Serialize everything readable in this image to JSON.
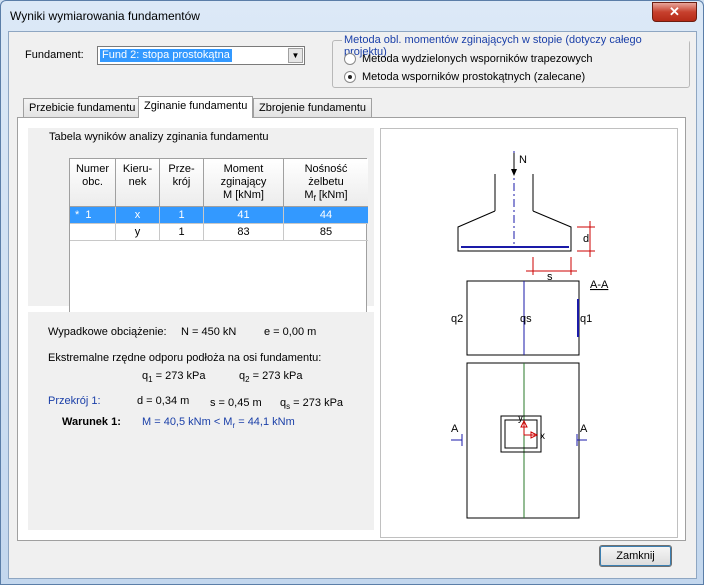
{
  "window": {
    "title": "Wyniki wymiarowania fundamentów",
    "close_glyph": "✕"
  },
  "fundament": {
    "label": "Fundament:",
    "selected": "Fund 2: stopa prostokątna"
  },
  "method": {
    "group_title": "Metoda obl. momentów zginających w stopie (dotyczy całego projektu)",
    "option1": "Metoda wydzielonych wsporników trapezowych",
    "option2": "Metoda wsporników prostokątnych (zalecane)",
    "selected": 2
  },
  "tabs": [
    {
      "label": "Przebicie fundamentu"
    },
    {
      "label": "Zginanie fundamentu"
    },
    {
      "label": "Zbrojenie fundamentu"
    }
  ],
  "table": {
    "caption": "Tabela wyników analizy zginania fundamentu",
    "headers": {
      "num": [
        "Numer",
        "obc."
      ],
      "dir": [
        "Kieru-",
        "nek"
      ],
      "sec": [
        "Prze-",
        "krój"
      ],
      "moment": [
        "Moment",
        "zginający",
        "M [kNm]"
      ],
      "capacity": [
        "Nośność",
        "żelbetu",
        "M",
        "f",
        " [kNm]"
      ]
    },
    "rows": [
      {
        "num": "1",
        "marker": "*",
        "dir": "x",
        "sec": "1",
        "m": "41",
        "mr": "44"
      },
      {
        "num": "",
        "marker": "",
        "dir": "y",
        "sec": "1",
        "m": "83",
        "mr": "85"
      }
    ]
  },
  "results": {
    "load_label": "Wypadkowe obciążenie:",
    "load_n": "N = 450 kN",
    "load_e": "e = 0,00 m",
    "pressure_label": "Ekstremalne rzędne odporu podłoża na osi fundamentu:",
    "q1_sym": "q",
    "q1_sub": "1",
    "q1_val": " = 273 kPa",
    "q2_sym": "q",
    "q2_sub": "2",
    "q2_val": " = 273 kPa",
    "section_label": "Przekrój 1:",
    "d": "d = 0,34 m",
    "s": "s = 0,45 m",
    "qs_sym": "q",
    "qs_sub": "s",
    "qs_val": " = 273 kPa",
    "condition_label": "Warunek 1:",
    "condition_pre": "M = 40,5 kNm < M",
    "condition_sub": "r",
    "condition_post": " = 44,1 kNm"
  },
  "diagram": {
    "n": "N",
    "d": "d",
    "s": "s",
    "section": "A-A",
    "q2": "q2",
    "qs": "qs",
    "q1": "q1",
    "y": "y",
    "x": "x",
    "a_left": "A",
    "a_right": "A"
  },
  "close_button": {
    "label": "Zamknij"
  }
}
